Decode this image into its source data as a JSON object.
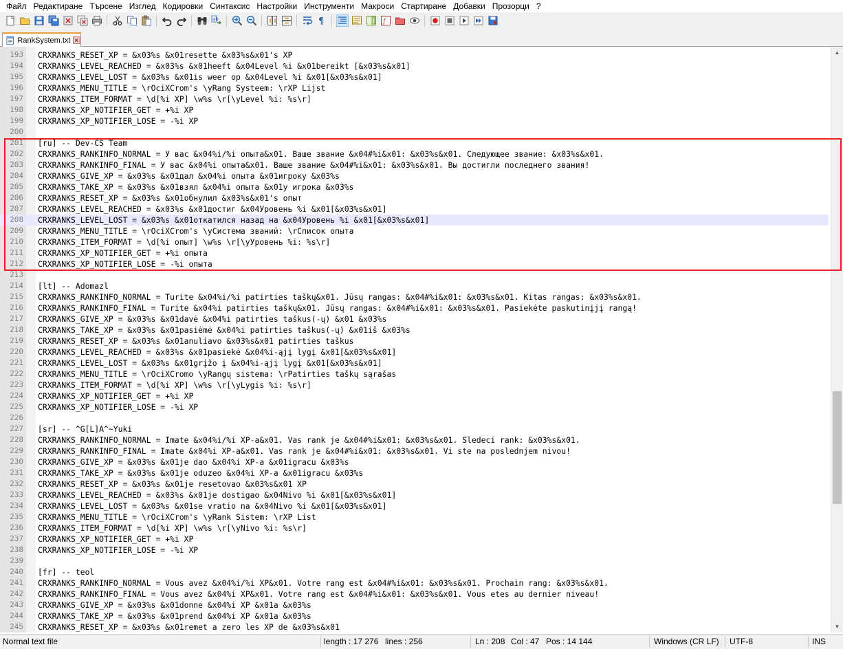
{
  "menubar": [
    "Файл",
    "Редактиране",
    "Търсене",
    "Изглед",
    "Кодировки",
    "Синтаксис",
    "Настройки",
    "Инструменти",
    "Макроси",
    "Стартиране",
    "Добавки",
    "Прозорци",
    "?"
  ],
  "toolbar": {
    "icons": [
      "new-file-icon",
      "open-file-icon",
      "save-icon",
      "save-all-icon",
      "close-icon",
      "close-all-icon",
      "print-icon",
      "|",
      "cut-icon",
      "copy-icon",
      "paste-icon",
      "|",
      "undo-icon",
      "redo-icon",
      "|",
      "find-icon",
      "replace-icon",
      "|",
      "zoom-in-icon",
      "zoom-out-icon",
      "|",
      "sync-vertical-icon",
      "sync-horizontal-icon",
      "|",
      "word-wrap-icon",
      "show-all-chars-icon",
      "|",
      "indent-guide-icon",
      "language-icon",
      "doc-map-icon",
      "function-list-icon",
      "folder-workspace-icon",
      "monitoring-icon",
      "|",
      "record-macro-icon",
      "stop-record-icon",
      "play-macro-icon",
      "run-macro-multiple-icon",
      "save-macro-icon"
    ],
    "active_index": 27
  },
  "tab": {
    "label": "RankSystem.txt",
    "icon": "notepad-file-icon"
  },
  "editor": {
    "current_line": 208,
    "lines": [
      {
        "n": "193",
        "t": "CRXRANKS_RESET_XP = &x03%s &x01resette &x03%s&x01's XP"
      },
      {
        "n": "194",
        "t": "CRXRANKS_LEVEL_REACHED = &x03%s &x01heeft &x04Level %i &x01bereikt [&x03%s&x01]"
      },
      {
        "n": "195",
        "t": "CRXRANKS_LEVEL_LOST = &x03%s &x01is weer op &x04Level %i &x01[&x03%s&x01]"
      },
      {
        "n": "196",
        "t": "CRXRANKS_MENU_TITLE = \\rOciXCrom's \\yRang Systeem: \\rXP Lijst"
      },
      {
        "n": "197",
        "t": "CRXRANKS_ITEM_FORMAT = \\d[%i XP] \\w%s \\r[\\yLevel %i: %s\\r]"
      },
      {
        "n": "198",
        "t": "CRXRANKS_XP_NOTIFIER_GET = +%i XP"
      },
      {
        "n": "199",
        "t": "CRXRANKS_XP_NOTIFIER_LOSE = -%i XP"
      },
      {
        "n": "200",
        "t": ""
      },
      {
        "n": "201",
        "t": "[ru] -- Dev-CS Team"
      },
      {
        "n": "202",
        "t": "CRXRANKS_RANKINFO_NORMAL = У вас &x04%i/%i опыта&x01. Ваше звание &x04#%i&x01: &x03%s&x01. Следующее звание: &x03%s&x01."
      },
      {
        "n": "203",
        "t": "CRXRANKS_RANKINFO_FINAL = У вас &x04%i опыта&x01. Ваше звание &x04#%i&x01: &x03%s&x01. Вы достигли последнего звания!"
      },
      {
        "n": "204",
        "t": "CRXRANKS_GIVE_XP = &x03%s &x01дал &x04%i опыта &x01игроку &x03%s"
      },
      {
        "n": "205",
        "t": "CRXRANKS_TAKE_XP = &x03%s &x01взял &x04%i опыта &x01у игрока &x03%s"
      },
      {
        "n": "206",
        "t": "CRXRANKS_RESET_XP = &x03%s &x01обнулил &x03%s&x01's опыт"
      },
      {
        "n": "207",
        "t": "CRXRANKS_LEVEL_REACHED = &x03%s &x01достиг &x04Уровень %i &x01[&x03%s&x01]"
      },
      {
        "n": "208",
        "t": "CRXRANKS_LEVEL_LOST = &x03%s &x01откатился назад на &x04Уровень %i &x01[&x03%s&x01]"
      },
      {
        "n": "209",
        "t": "CRXRANKS_MENU_TITLE = \\rOciXCrom's \\yСистема званий: \\rСписок опыта"
      },
      {
        "n": "210",
        "t": "CRXRANKS_ITEM_FORMAT = \\d[%i опыт] \\w%s \\r[\\yУровень %i: %s\\r]"
      },
      {
        "n": "211",
        "t": "CRXRANKS_XP_NOTIFIER_GET = +%i опыта"
      },
      {
        "n": "212",
        "t": "CRXRANKS_XP_NOTIFIER_LOSE = -%i опыта"
      },
      {
        "n": "213",
        "t": ""
      },
      {
        "n": "214",
        "t": "[lt] -- Adomazl"
      },
      {
        "n": "215",
        "t": "CRXRANKS_RANKINFO_NORMAL = Turite &x04%i/%i patirties taškų&x01. Jūsų rangas: &x04#%i&x01: &x03%s&x01. Kitas rangas: &x03%s&x01."
      },
      {
        "n": "216",
        "t": "CRXRANKS_RANKINFO_FINAL = Turite &x04%i patirties taškų&x01. Jūsų rangas: &x04#%i&x01: &x03%s&x01. Pasiekėte paskutinįjį rangą!"
      },
      {
        "n": "217",
        "t": "CRXRANKS_GIVE_XP = &x03%s &x01davė &x04%i patirties taškus(-ų) &x01 &x03%s"
      },
      {
        "n": "218",
        "t": "CRXRANKS_TAKE_XP = &x03%s &x01pasiėmė &x04%i patirties taškus(-ų) &x01iš &x03%s"
      },
      {
        "n": "219",
        "t": "CRXRANKS_RESET_XP = &x03%s &x01anuliavo &x03%s&x01 patirties taškus"
      },
      {
        "n": "220",
        "t": "CRXRANKS_LEVEL_REACHED = &x03%s &x01pasiekė &x04%i-ąjį lygį &x01[&x03%s&x01]"
      },
      {
        "n": "221",
        "t": "CRXRANKS_LEVEL_LOST = &x03%s &x01grįžo į &x04%i-ąjį lygį &x01[&x03%s&x01]"
      },
      {
        "n": "222",
        "t": "CRXRANKS_MENU_TITLE = \\rOciXCromo \\yRangų sistema: \\rPatirties taškų sąrašas"
      },
      {
        "n": "223",
        "t": "CRXRANKS_ITEM_FORMAT = \\d[%i XP] \\w%s \\r[\\yLygis %i: %s\\r]"
      },
      {
        "n": "224",
        "t": "CRXRANKS_XP_NOTIFIER_GET = +%i XP"
      },
      {
        "n": "225",
        "t": "CRXRANKS_XP_NOTIFIER_LOSE = -%i XP"
      },
      {
        "n": "226",
        "t": ""
      },
      {
        "n": "227",
        "t": "[sr] -- ^G[L]A^~Yuki"
      },
      {
        "n": "228",
        "t": "CRXRANKS_RANKINFO_NORMAL = Imate &x04%i/%i XP-a&x01. Vas rank je &x04#%i&x01: &x03%s&x01. Sledeci rank: &x03%s&x01."
      },
      {
        "n": "229",
        "t": "CRXRANKS_RANKINFO_FINAL = Imate &x04%i XP-a&x01. Vas rank je &x04#%i&x01: &x03%s&x01. Vi ste na poslednjem nivou!"
      },
      {
        "n": "230",
        "t": "CRXRANKS_GIVE_XP = &x03%s &x01je dao &x04%i XP-a &x01igracu &x03%s"
      },
      {
        "n": "231",
        "t": "CRXRANKS_TAKE_XP = &x03%s &x01je oduzeo &x04%i XP-a &x01igracu &x03%s"
      },
      {
        "n": "232",
        "t": "CRXRANKS_RESET_XP = &x03%s &x01je resetovao &x03%s&x01 XP"
      },
      {
        "n": "233",
        "t": "CRXRANKS_LEVEL_REACHED = &x03%s &x01je dostigao &x04Nivo %i &x01[&x03%s&x01]"
      },
      {
        "n": "234",
        "t": "CRXRANKS_LEVEL_LOST = &x03%s &x01se vratio na &x04Nivo %i &x01[&x03%s&x01]"
      },
      {
        "n": "235",
        "t": "CRXRANKS_MENU_TITLE = \\rOciXCrom's \\yRank Sistem: \\rXP List"
      },
      {
        "n": "236",
        "t": "CRXRANKS_ITEM_FORMAT = \\d[%i XP] \\w%s \\r[\\yNivo %i: %s\\r]"
      },
      {
        "n": "237",
        "t": "CRXRANKS_XP_NOTIFIER_GET = +%i XP"
      },
      {
        "n": "238",
        "t": "CRXRANKS_XP_NOTIFIER_LOSE = -%i XP"
      },
      {
        "n": "239",
        "t": ""
      },
      {
        "n": "240",
        "t": "[fr] -- teol"
      },
      {
        "n": "241",
        "t": "CRXRANKS_RANKINFO_NORMAL = Vous avez &x04%i/%i XP&x01. Votre rang est &x04#%i&x01: &x03%s&x01. Prochain rang: &x03%s&x01."
      },
      {
        "n": "242",
        "t": "CRXRANKS_RANKINFO_FINAL = Vous avez &x04%i XP&x01. Votre rang est &x04#%i&x01: &x03%s&x01. Vous etes au dernier niveau!"
      },
      {
        "n": "243",
        "t": "CRXRANKS_GIVE_XP = &x03%s &x01donne &x04%i XP &x01a &x03%s"
      },
      {
        "n": "244",
        "t": "CRXRANKS_TAKE_XP = &x03%s &x01prend &x04%i XP &x01a &x03%s"
      },
      {
        "n": "245",
        "t": "CRXRANKS_RESET_XP = &x03%s &x01remet a zero les XP de &x03%s&x01"
      }
    ]
  },
  "scrollbar": {
    "position": 0.74,
    "visible_fraction": 0.2
  },
  "statusbar": {
    "filetype": "Normal text file",
    "length": "length : 17 276",
    "lines": "lines : 256",
    "ln": "Ln : 208",
    "col": "Col : 47",
    "pos": "Pos : 14 144",
    "eol": "Windows (CR LF)",
    "encoding": "UTF-8",
    "mode": "INS"
  },
  "colors": {
    "highlight_box": "#e52121",
    "current_line": "#e8e8ff",
    "tab_accent": "#f29c38"
  }
}
